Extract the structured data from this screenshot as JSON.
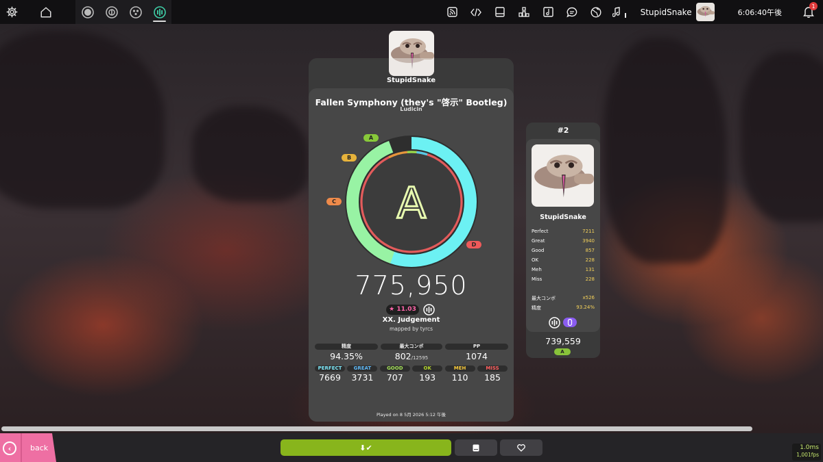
{
  "topbar": {
    "user_name": "StupidSnake",
    "clock": "6:06:40午後",
    "notification_count": "1",
    "icons_left": [
      "gear-icon",
      "home-icon"
    ],
    "rulesets": [
      "osu-icon",
      "taiko-icon",
      "catch-icon",
      "mania-icon"
    ],
    "icons_right": [
      "rss-icon",
      "code-icon",
      "book-icon",
      "ranking-icon",
      "beatmap-listing-icon",
      "chat-icon",
      "globe-icon",
      "music-icon"
    ]
  },
  "score_panel": {
    "player_name": "StupidSnake",
    "title": "Fallen Symphony (they's \"啓示\" Bootleg)",
    "artist": "Ludicin",
    "grade": "A",
    "accuracy_fraction": 0.9435,
    "grade_labels": {
      "a": "A",
      "b": "B",
      "c": "C",
      "d": "D"
    },
    "total_score": "775,950",
    "star_rating": "★ 11.03",
    "difficulty": "XX. Judgement",
    "mapper": "mapped by tyrcs",
    "stats_top": [
      {
        "label": "精度",
        "value": "94.35%",
        "sub": ""
      },
      {
        "label": "最大コンボ",
        "value": "802",
        "sub": "/12595"
      },
      {
        "label": "PP",
        "value": "1074",
        "sub": ""
      }
    ],
    "stats_hits": [
      {
        "label": "PERFECT",
        "value": "7669",
        "color": "#7ee8f8"
      },
      {
        "label": "GREAT",
        "value": "3731",
        "color": "#5fb8f5"
      },
      {
        "label": "GOOD",
        "value": "707",
        "color": "#a6e35a"
      },
      {
        "label": "OK",
        "value": "193",
        "color": "#b5d62c"
      },
      {
        "label": "MEH",
        "value": "110",
        "color": "#f7c93b"
      },
      {
        "label": "MISS",
        "value": "185",
        "color": "#ff5f5f"
      }
    ],
    "played_on": "Played on 8 5月 2026 5:12 午後"
  },
  "side_panel": {
    "rank": "#2",
    "player_name": "StupidSnake",
    "rows": [
      {
        "label": "Perfect",
        "value": "7211"
      },
      {
        "label": "Great",
        "value": "3940"
      },
      {
        "label": "Good",
        "value": "857"
      },
      {
        "label": "OK",
        "value": "228"
      },
      {
        "label": "Meh",
        "value": "131"
      },
      {
        "label": "Miss",
        "value": "228"
      }
    ],
    "rows2": [
      {
        "label": "最大コンボ",
        "value": "x526"
      },
      {
        "label": "精度",
        "value": "93.24%"
      }
    ],
    "score": "739,559",
    "grade": "A"
  },
  "bottom": {
    "back_label": "back",
    "download_label": "⬇✔",
    "fps_ms": "1.0ms",
    "fps_rate": "1,001fps"
  },
  "colors": {
    "accent_green": "#88b51c",
    "back_pink": "#ee6fa3",
    "ring_cyan": "#6ff0f0",
    "ring_green": "#96f2a8",
    "ring_red": "#e05a5a"
  }
}
